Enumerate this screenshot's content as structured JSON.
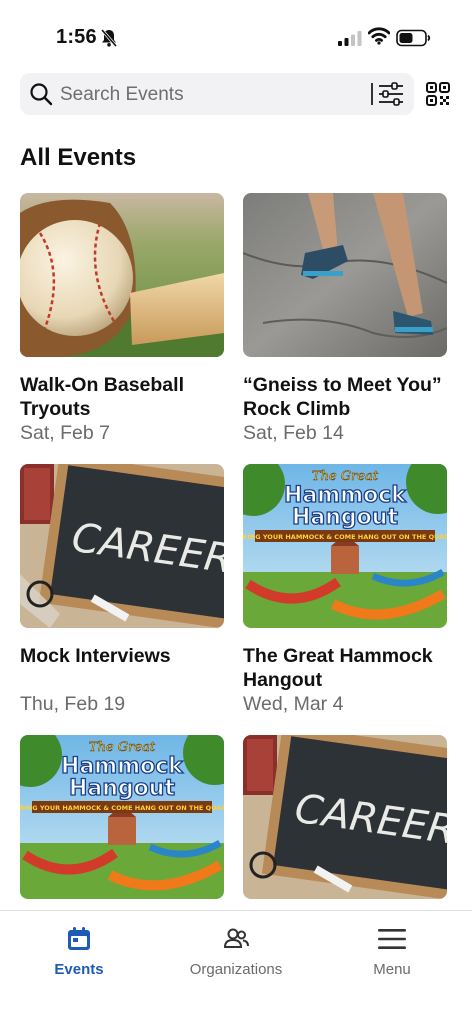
{
  "status_bar": {
    "time": "1:56"
  },
  "search": {
    "placeholder": "Search Events"
  },
  "section": {
    "title": "All Events"
  },
  "events": [
    {
      "title_line1": "Walk-On Baseball",
      "title_line2": "Tryouts",
      "date": "Sat, Feb 7",
      "image": "baseball"
    },
    {
      "title_line1": "“Gneiss to Meet You”",
      "title_line2": "Rock Climb",
      "date": "Sat, Feb 14",
      "image": "rock-climb"
    },
    {
      "title_line1": "Mock Interviews",
      "title_line2": "",
      "date": "Thu, Feb 19",
      "image": "career-chalkboard"
    },
    {
      "title_line1": "The Great Hammock",
      "title_line2": "Hangout",
      "date": "Wed, Mar 4",
      "image": "hammock-poster"
    },
    {
      "image": "hammock-poster"
    },
    {
      "image": "career-chalkboard"
    }
  ],
  "poster": {
    "line1": "The Great",
    "line2": "Hammock",
    "line3": "Hangout",
    "banner": "BRING YOUR HAMMOCK & COME HANG OUT ON THE QUAD!"
  },
  "chalkboard": {
    "word": "CAREER"
  },
  "tabs": [
    {
      "label": "Events",
      "icon": "calendar-icon",
      "active": true
    },
    {
      "label": "Organizations",
      "icon": "people-icon",
      "active": false
    },
    {
      "label": "Menu",
      "icon": "hamburger-icon",
      "active": false
    }
  ],
  "colors": {
    "accent": "#1e5bb8",
    "search_bg": "#f2f2f4",
    "secondary_text": "#6b6b6b"
  }
}
